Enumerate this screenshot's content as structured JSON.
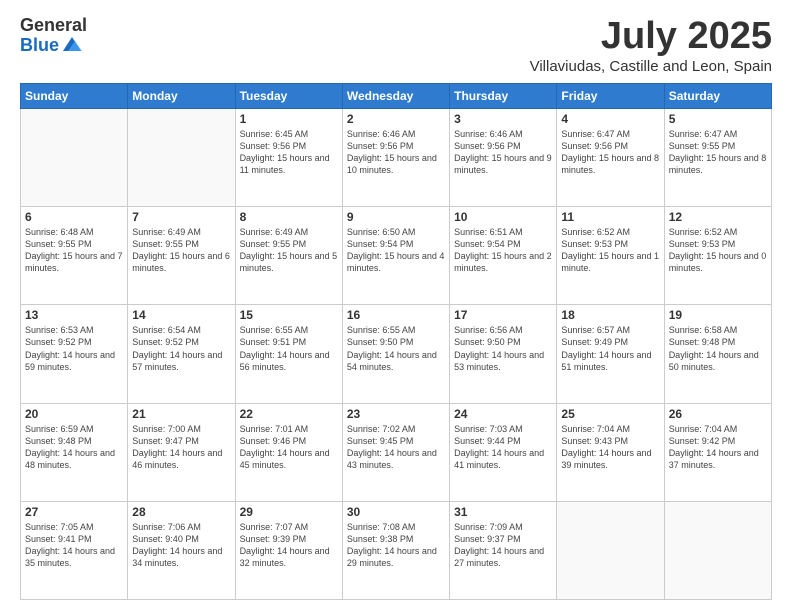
{
  "logo": {
    "general": "General",
    "blue": "Blue"
  },
  "header": {
    "month": "July 2025",
    "location": "Villaviudas, Castille and Leon, Spain"
  },
  "weekdays": [
    "Sunday",
    "Monday",
    "Tuesday",
    "Wednesday",
    "Thursday",
    "Friday",
    "Saturday"
  ],
  "weeks": [
    [
      {
        "day": "",
        "info": ""
      },
      {
        "day": "",
        "info": ""
      },
      {
        "day": "1",
        "info": "Sunrise: 6:45 AM\nSunset: 9:56 PM\nDaylight: 15 hours and 11 minutes."
      },
      {
        "day": "2",
        "info": "Sunrise: 6:46 AM\nSunset: 9:56 PM\nDaylight: 15 hours and 10 minutes."
      },
      {
        "day": "3",
        "info": "Sunrise: 6:46 AM\nSunset: 9:56 PM\nDaylight: 15 hours and 9 minutes."
      },
      {
        "day": "4",
        "info": "Sunrise: 6:47 AM\nSunset: 9:56 PM\nDaylight: 15 hours and 8 minutes."
      },
      {
        "day": "5",
        "info": "Sunrise: 6:47 AM\nSunset: 9:55 PM\nDaylight: 15 hours and 8 minutes."
      }
    ],
    [
      {
        "day": "6",
        "info": "Sunrise: 6:48 AM\nSunset: 9:55 PM\nDaylight: 15 hours and 7 minutes."
      },
      {
        "day": "7",
        "info": "Sunrise: 6:49 AM\nSunset: 9:55 PM\nDaylight: 15 hours and 6 minutes."
      },
      {
        "day": "8",
        "info": "Sunrise: 6:49 AM\nSunset: 9:55 PM\nDaylight: 15 hours and 5 minutes."
      },
      {
        "day": "9",
        "info": "Sunrise: 6:50 AM\nSunset: 9:54 PM\nDaylight: 15 hours and 4 minutes."
      },
      {
        "day": "10",
        "info": "Sunrise: 6:51 AM\nSunset: 9:54 PM\nDaylight: 15 hours and 2 minutes."
      },
      {
        "day": "11",
        "info": "Sunrise: 6:52 AM\nSunset: 9:53 PM\nDaylight: 15 hours and 1 minute."
      },
      {
        "day": "12",
        "info": "Sunrise: 6:52 AM\nSunset: 9:53 PM\nDaylight: 15 hours and 0 minutes."
      }
    ],
    [
      {
        "day": "13",
        "info": "Sunrise: 6:53 AM\nSunset: 9:52 PM\nDaylight: 14 hours and 59 minutes."
      },
      {
        "day": "14",
        "info": "Sunrise: 6:54 AM\nSunset: 9:52 PM\nDaylight: 14 hours and 57 minutes."
      },
      {
        "day": "15",
        "info": "Sunrise: 6:55 AM\nSunset: 9:51 PM\nDaylight: 14 hours and 56 minutes."
      },
      {
        "day": "16",
        "info": "Sunrise: 6:55 AM\nSunset: 9:50 PM\nDaylight: 14 hours and 54 minutes."
      },
      {
        "day": "17",
        "info": "Sunrise: 6:56 AM\nSunset: 9:50 PM\nDaylight: 14 hours and 53 minutes."
      },
      {
        "day": "18",
        "info": "Sunrise: 6:57 AM\nSunset: 9:49 PM\nDaylight: 14 hours and 51 minutes."
      },
      {
        "day": "19",
        "info": "Sunrise: 6:58 AM\nSunset: 9:48 PM\nDaylight: 14 hours and 50 minutes."
      }
    ],
    [
      {
        "day": "20",
        "info": "Sunrise: 6:59 AM\nSunset: 9:48 PM\nDaylight: 14 hours and 48 minutes."
      },
      {
        "day": "21",
        "info": "Sunrise: 7:00 AM\nSunset: 9:47 PM\nDaylight: 14 hours and 46 minutes."
      },
      {
        "day": "22",
        "info": "Sunrise: 7:01 AM\nSunset: 9:46 PM\nDaylight: 14 hours and 45 minutes."
      },
      {
        "day": "23",
        "info": "Sunrise: 7:02 AM\nSunset: 9:45 PM\nDaylight: 14 hours and 43 minutes."
      },
      {
        "day": "24",
        "info": "Sunrise: 7:03 AM\nSunset: 9:44 PM\nDaylight: 14 hours and 41 minutes."
      },
      {
        "day": "25",
        "info": "Sunrise: 7:04 AM\nSunset: 9:43 PM\nDaylight: 14 hours and 39 minutes."
      },
      {
        "day": "26",
        "info": "Sunrise: 7:04 AM\nSunset: 9:42 PM\nDaylight: 14 hours and 37 minutes."
      }
    ],
    [
      {
        "day": "27",
        "info": "Sunrise: 7:05 AM\nSunset: 9:41 PM\nDaylight: 14 hours and 35 minutes."
      },
      {
        "day": "28",
        "info": "Sunrise: 7:06 AM\nSunset: 9:40 PM\nDaylight: 14 hours and 34 minutes."
      },
      {
        "day": "29",
        "info": "Sunrise: 7:07 AM\nSunset: 9:39 PM\nDaylight: 14 hours and 32 minutes."
      },
      {
        "day": "30",
        "info": "Sunrise: 7:08 AM\nSunset: 9:38 PM\nDaylight: 14 hours and 29 minutes."
      },
      {
        "day": "31",
        "info": "Sunrise: 7:09 AM\nSunset: 9:37 PM\nDaylight: 14 hours and 27 minutes."
      },
      {
        "day": "",
        "info": ""
      },
      {
        "day": "",
        "info": ""
      }
    ]
  ]
}
